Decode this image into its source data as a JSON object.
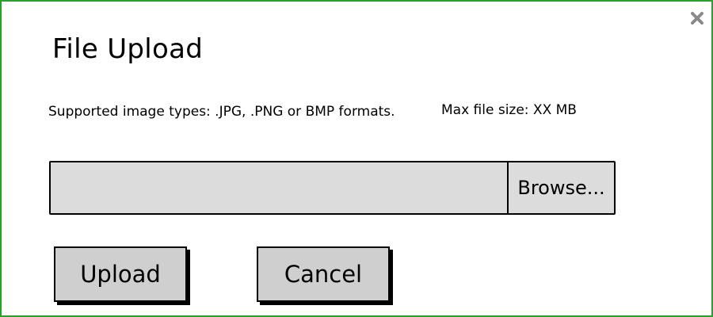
{
  "dialog": {
    "title": "File Upload",
    "close_icon": "close-icon",
    "border_color": "#2aa12a",
    "supported_types_text": "Supported image types: .JPG, .PNG or BMP formats.",
    "max_size_text": "Max file size: XX MB"
  },
  "file_input": {
    "value": "",
    "placeholder": ""
  },
  "buttons": {
    "browse_label": "Browse...",
    "upload_label": "Upload",
    "cancel_label": "Cancel"
  }
}
